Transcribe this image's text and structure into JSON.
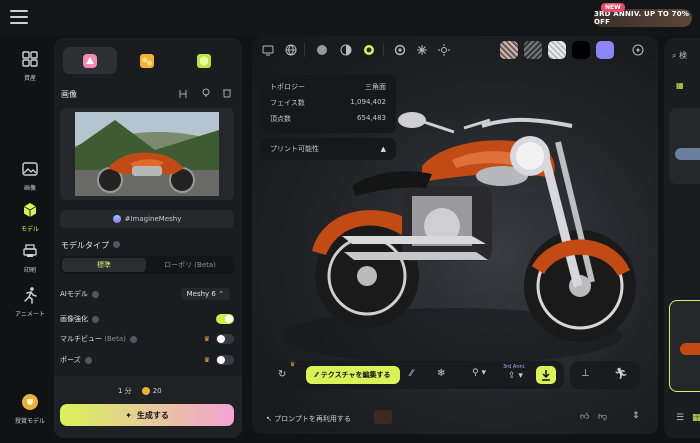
{
  "promo": {
    "new_label": "NEW",
    "text": "3RD ANNIV. UP TO 70% OFF"
  },
  "nav": [
    {
      "label": "資産",
      "icon": "grid-icon"
    },
    {
      "label": "画像",
      "icon": "image-icon"
    },
    {
      "label": "モデル",
      "icon": "cube-icon"
    },
    {
      "label": "印刷",
      "icon": "printer-icon"
    },
    {
      "label": "アニメート",
      "icon": "running-person-icon"
    },
    {
      "label": "授賞モデル",
      "icon": "trophy-icon"
    }
  ],
  "left": {
    "image_title": "画像",
    "tag": "#ImagineMeshy",
    "model_type_label": "モデルタイプ",
    "type_standard": "標準",
    "type_low": "ローポリ (Beta)",
    "ai_model_label": "AIモデル",
    "ai_model_value": "Meshy 6",
    "enhance_label": "画像強化",
    "multiview_label": "マルチビュー",
    "multiview_beta": "(Beta)",
    "pose_label": "ポーズ",
    "time_value": "1 分",
    "credits_value": "20",
    "generate_label": "生成する"
  },
  "viewport": {
    "stats": [
      {
        "label": "トポロジー",
        "value": "三角面"
      },
      {
        "label": "フェイス数",
        "value": "1,094,402"
      },
      {
        "label": "頂点数",
        "value": "654,483"
      }
    ],
    "printable_label": "プリント可能性",
    "edit_texture_label": "テクスチャを編集する",
    "badge_3rd": "3rd Anni.",
    "reuse_prompt_label": "プロンプトを再利用する"
  },
  "right": {
    "search_placeholder": "検"
  },
  "colors": {
    "accent": "#d9f25a",
    "pink": "#f3a3d4",
    "body_orange": "#c24a14"
  }
}
